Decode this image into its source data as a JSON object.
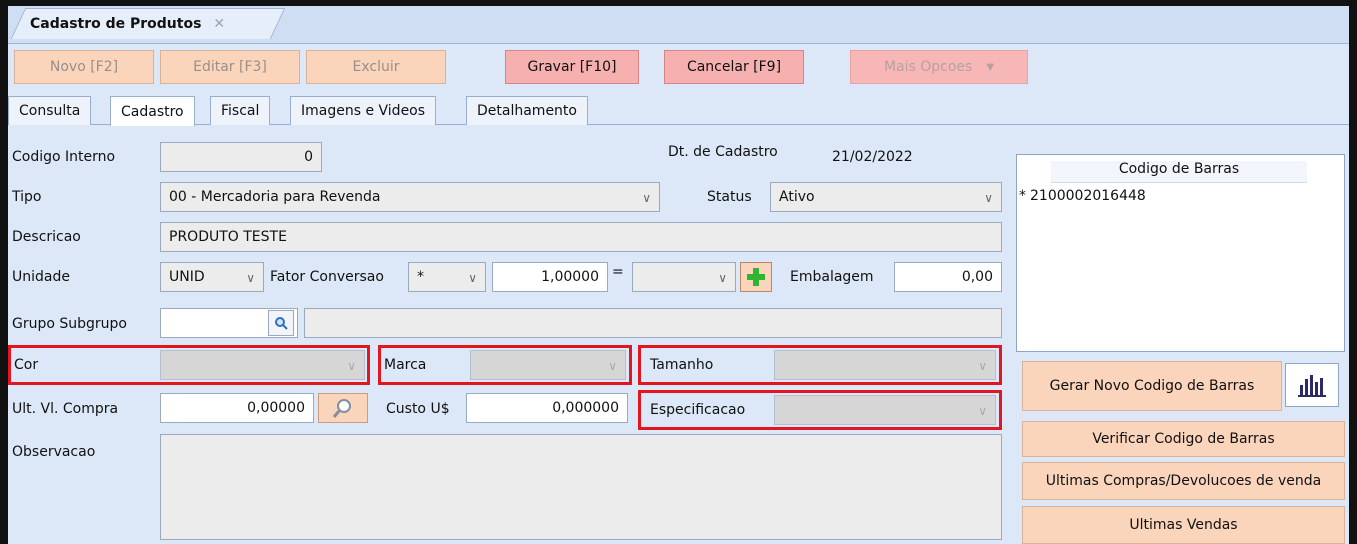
{
  "window": {
    "doc_tab_title": "Cadastro de Produtos"
  },
  "toolbar": {
    "novo": "Novo [F2]",
    "editar": "Editar [F3]",
    "excluir": "Excluir",
    "gravar": "Gravar [F10]",
    "cancelar": "Cancelar [F9]",
    "mais_opcoes": "Mais Opcoes"
  },
  "tabs": [
    "Consulta",
    "Cadastro",
    "Fiscal",
    "Imagens e Videos",
    "Detalhamento"
  ],
  "form": {
    "codigo_interno_label": "Codigo Interno",
    "codigo_interno_value": "0",
    "dt_cadastro_label": "Dt. de Cadastro",
    "dt_cadastro_value": "21/02/2022",
    "tipo_label": "Tipo",
    "tipo_value": "00 - Mercadoria para Revenda",
    "status_label": "Status",
    "status_value": "Ativo",
    "descricao_label": "Descricao",
    "descricao_value": "PRODUTO TESTE",
    "unidade_label": "Unidade",
    "unidade_value": "UNID",
    "fator_label": "Fator Conversao",
    "fator_op": "*",
    "fator_value": "1,00000",
    "equals": "=",
    "embalagem_label": "Embalagem",
    "embalagem_value": "0,00",
    "grupo_label": "Grupo Subgrupo",
    "cor_label": "Cor",
    "marca_label": "Marca",
    "tamanho_label": "Tamanho",
    "ult_compra_label": "Ult. Vl. Compra",
    "ult_compra_value": "0,00000",
    "custo_label": "Custo U$",
    "custo_value": "0,000000",
    "especificacao_label": "Especificacao",
    "observacao_label": "Observacao"
  },
  "barcode": {
    "header": "Codigo de Barras",
    "rows": [
      {
        "marker": "*",
        "code": "2100002016448"
      }
    ]
  },
  "side_buttons": {
    "gerar": "Gerar Novo Codigo de Barras",
    "verificar": "Verificar Codigo de Barras",
    "ultimas_compras": "Ultimas Compras/Devolucoes de venda",
    "ultimas_vendas": "Ultimas Vendas"
  },
  "colors": {
    "highlight": "#e2161f",
    "button_peach": "#fbd4bc",
    "button_red": "#f7b0b0",
    "background": "#dce8f7"
  }
}
